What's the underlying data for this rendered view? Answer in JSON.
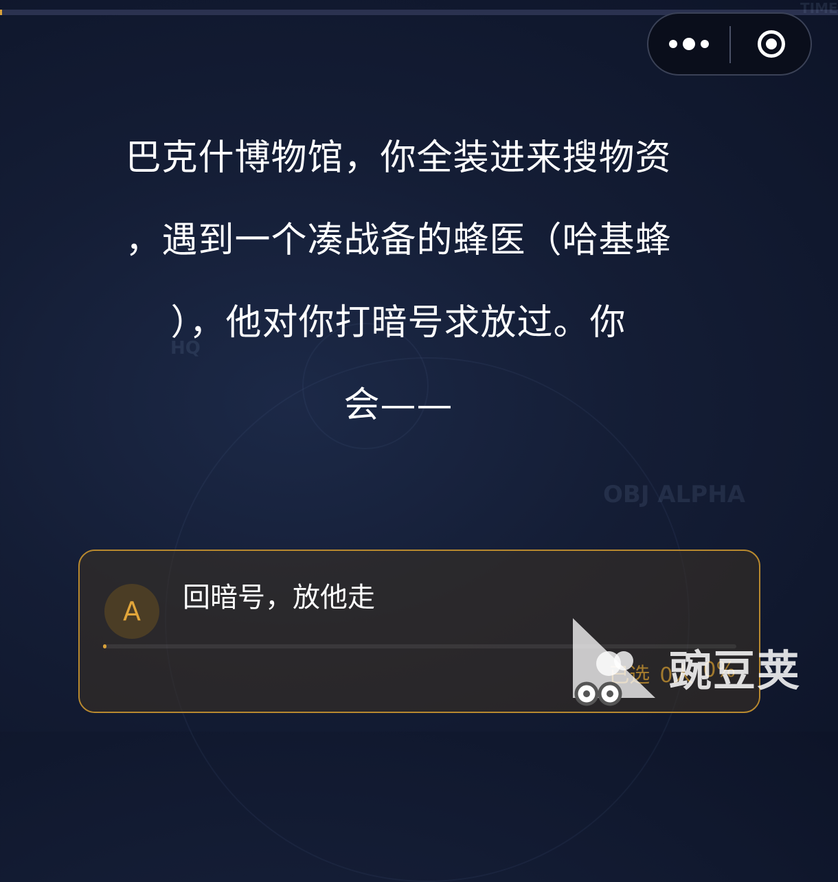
{
  "background": {
    "deco_top_right": "TIME",
    "deco_left": "HQ",
    "deco_right": "OBJ ALPHA"
  },
  "capsule": {
    "more_icon": "more-dots-icon",
    "close_icon": "target-close-icon"
  },
  "question": {
    "lines": [
      "巴克什博物馆，你全装进来搜物资",
      "，遇到一个凑战备的蜂医（哈基蜂",
      "），他对你打暗号求放过。你",
      "会——"
    ]
  },
  "options": [
    {
      "letter": "A",
      "text": "回暗号，放他走",
      "selected_label": "已选",
      "count": "0人",
      "percent": "0%",
      "progress": 0.005
    }
  ],
  "colors": {
    "accent": "#d8a13a",
    "card_border": "#b8892f",
    "background": "#141d35"
  },
  "watermark": {
    "text": "豌豆荚"
  }
}
